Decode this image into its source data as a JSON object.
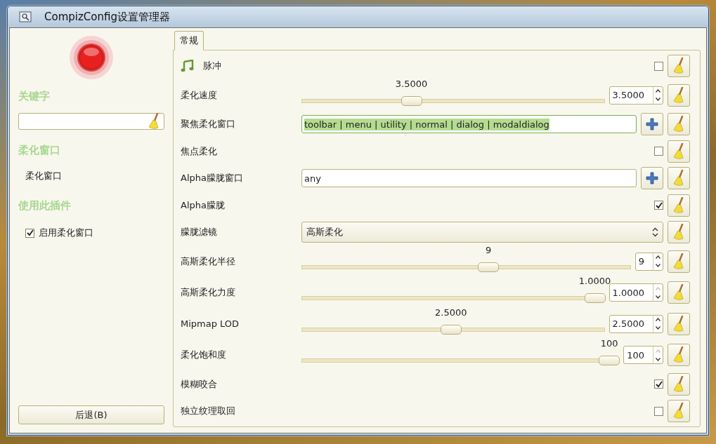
{
  "window": {
    "title": "CompizConfig设置管理器"
  },
  "sidebar": {
    "search": {
      "heading": "关键字"
    },
    "plugin_heading": "柔化窗口",
    "plugin_items": [
      "柔化窗口"
    ],
    "use_heading": "使用此插件",
    "enable": {
      "label": "启用柔化窗口",
      "checked": true
    },
    "back_button": "后退(B)"
  },
  "tabs": [
    {
      "label": "常规",
      "selected": true
    }
  ],
  "settings": [
    {
      "kind": "checkbox",
      "label": "脉冲",
      "icon": true,
      "checked": false
    },
    {
      "kind": "slider",
      "label": "柔化速度",
      "value_label": "3.5000",
      "value": "3.5000",
      "level": 0.35,
      "up_disabled": false
    },
    {
      "kind": "list",
      "label": "聚焦柔化窗口",
      "value": "toolbar | menu | utility | normal | dialog | modaldialog",
      "selected": true
    },
    {
      "kind": "checkbox",
      "label": "焦点柔化",
      "checked": false
    },
    {
      "kind": "list",
      "label": "Alpha朦胧窗口",
      "value": "any",
      "selected": false
    },
    {
      "kind": "checkbox",
      "label": "Alpha朦胧",
      "checked": true
    },
    {
      "kind": "combo",
      "label": "朦胧滤镜",
      "value": "高斯柔化"
    },
    {
      "kind": "slider",
      "label": "高斯柔化半径",
      "value_label": "9",
      "value": "9",
      "level": 0.57,
      "up_disabled": false
    },
    {
      "kind": "slider",
      "label": "高斯柔化力度",
      "value_label": "1.0000",
      "value": "1.0000",
      "level": 1.0,
      "up_disabled": true
    },
    {
      "kind": "slider",
      "label": "Mipmap LOD",
      "value_label": "2.5000",
      "value": "2.5000",
      "level": 0.49,
      "up_disabled": false
    },
    {
      "kind": "slider",
      "label": "柔化饱和度",
      "value_label": "100",
      "value": "100",
      "level": 1.0,
      "up_disabled": true
    },
    {
      "kind": "checkbox",
      "label": "模糊咬合",
      "checked": true
    },
    {
      "kind": "checkbox",
      "label": "独立纹理取回",
      "checked": false
    }
  ]
}
